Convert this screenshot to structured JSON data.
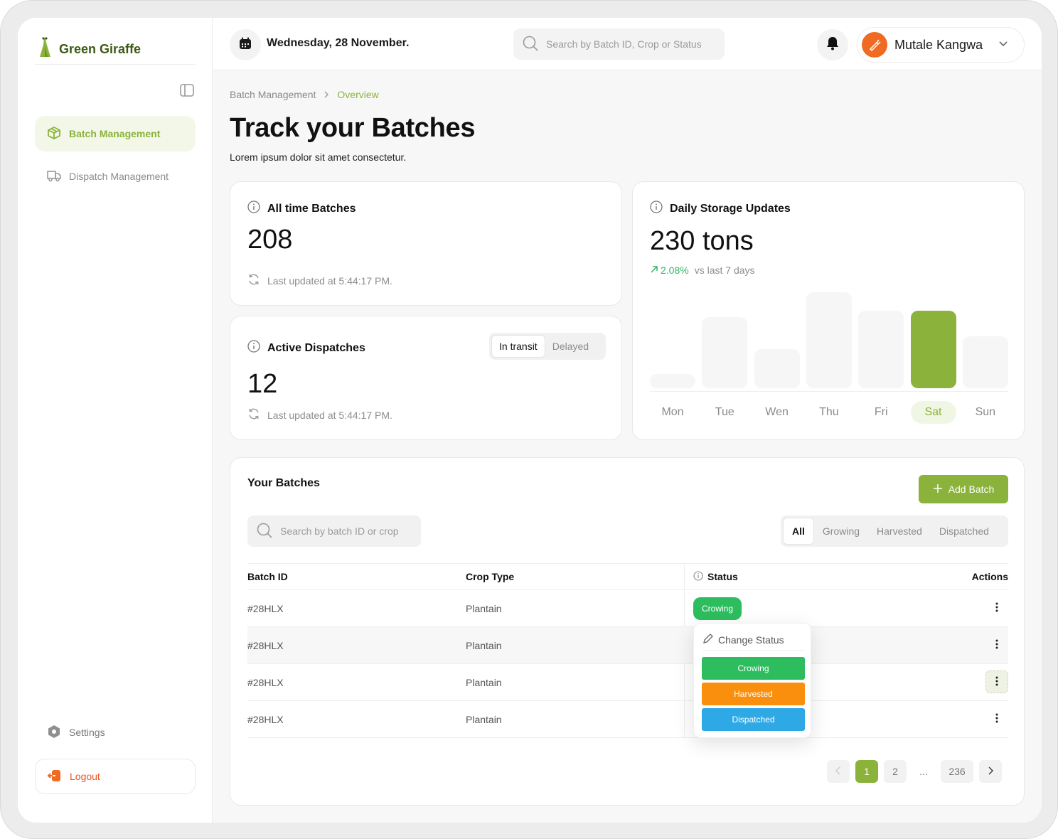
{
  "brand": {
    "name": "Green Giraffe"
  },
  "sidebar": {
    "items": [
      {
        "label": "Batch Management",
        "icon": "box-icon",
        "active": true
      },
      {
        "label": "Dispatch Management",
        "icon": "truck-icon",
        "active": false
      }
    ],
    "settings_label": "Settings",
    "logout_label": "Logout"
  },
  "header": {
    "date": "Wednesday, 28 November.",
    "search_placeholder": "Search by Batch ID, Crop or Status",
    "user_name": "Mutale Kangwa"
  },
  "breadcrumb": {
    "parent": "Batch Management",
    "current": "Overview"
  },
  "page": {
    "title": "Track your Batches",
    "subtitle": "Lorem ipsum dolor sit amet consectetur."
  },
  "cards": {
    "all_time": {
      "title": "All time Batches",
      "value": "208",
      "updated": "Last updated at 5:44:17 PM."
    },
    "dispatches": {
      "title": "Active Dispatches",
      "value": "12",
      "updated": "Last updated at 5:44:17 PM.",
      "tabs": [
        "In transit",
        "Delayed"
      ],
      "active_tab": "In transit"
    },
    "storage": {
      "title": "Daily Storage Updates",
      "value": "230 tons",
      "delta": "2.08%",
      "delta_note": "vs last 7 days",
      "days": [
        "Mon",
        "Tue",
        "Wen",
        "Thu",
        "Fri",
        "Sat",
        "Sun"
      ],
      "levels": [
        0.15,
        0.74,
        0.41,
        1.0,
        0.81,
        0.81,
        0.54
      ],
      "highlight_day": "Sat"
    }
  },
  "batches": {
    "title": "Your Batches",
    "add_label": "Add Batch",
    "search_placeholder": "Search by batch ID or crop",
    "filters": [
      "All",
      "Growing",
      "Harvested",
      "Dispatched"
    ],
    "active_filter": "All",
    "columns": {
      "id": "Batch ID",
      "crop": "Crop Type",
      "status": "Status",
      "actions": "Actions"
    },
    "rows": [
      {
        "id": "#28HLX",
        "crop": "Plantain",
        "status": "Crowing"
      },
      {
        "id": "#28HLX",
        "crop": "Plantain",
        "status": ""
      },
      {
        "id": "#28HLX",
        "crop": "Plantain",
        "status": ""
      },
      {
        "id": "#28HLX",
        "crop": "Plantain",
        "status": ""
      }
    ],
    "popover": {
      "title": "Change Status",
      "options": [
        {
          "label": "Crowing",
          "color": "#2dbd5e"
        },
        {
          "label": "Harvested",
          "color": "#f98f0c"
        },
        {
          "label": "Dispatched",
          "color": "#2fa9e6"
        }
      ]
    },
    "pagination": {
      "pages": [
        "1",
        "2",
        "...",
        "236"
      ],
      "current": "1"
    }
  },
  "colors": {
    "accent": "#8bb33b",
    "logout": "#e8551e",
    "avatar": "#f06a22"
  }
}
